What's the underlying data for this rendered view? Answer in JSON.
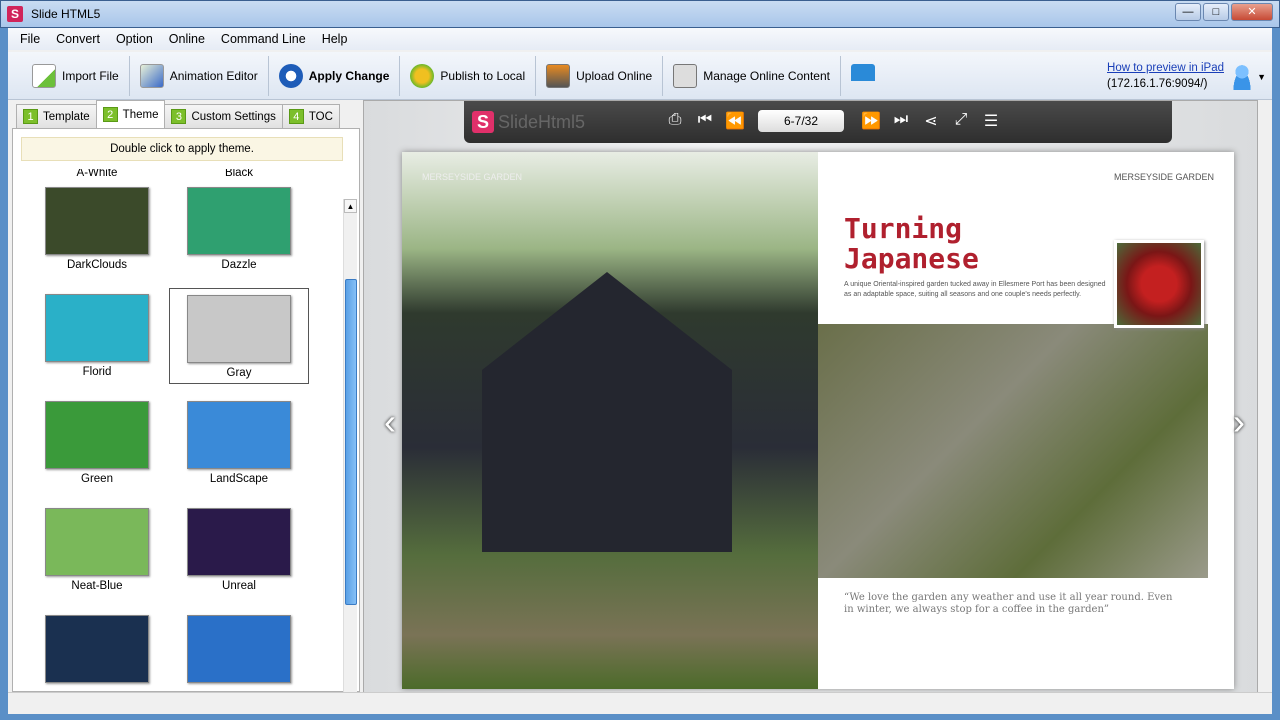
{
  "window": {
    "title": "Slide HTML5",
    "min": "—",
    "max": "□",
    "close": "✕"
  },
  "menu": [
    "File",
    "Convert",
    "Option",
    "Online",
    "Command Line",
    "Help"
  ],
  "toolbar": {
    "import": "Import File",
    "animation": "Animation Editor",
    "apply": "Apply Change",
    "publish": "Publish to Local",
    "upload": "Upload Online",
    "manage": "Manage Online Content",
    "help_link": "How to preview in iPad",
    "address": "(172.16.1.76:9094/)"
  },
  "tabs": [
    {
      "num": "1",
      "label": "Template"
    },
    {
      "num": "2",
      "label": "Theme"
    },
    {
      "num": "3",
      "label": "Custom Settings"
    },
    {
      "num": "4",
      "label": "TOC"
    }
  ],
  "hint": "Double click to apply theme.",
  "themes": [
    {
      "name": "A-White"
    },
    {
      "name": "Black"
    },
    {
      "name": "DarkClouds",
      "color": "#3b4a2a"
    },
    {
      "name": "Dazzle",
      "color": "#2fa070"
    },
    {
      "name": "Florid",
      "color": "#2ab0c8"
    },
    {
      "name": "Gray",
      "color": "#c8c8c8"
    },
    {
      "name": "Green",
      "color": "#3a9a3a"
    },
    {
      "name": "LandScape",
      "color": "#3a8ad8"
    },
    {
      "name": "Neat-Blue",
      "color": "#7ab85a"
    },
    {
      "name": "Unreal",
      "color": "#2a1a4a"
    },
    {
      "name": "",
      "color": "#1a3050"
    },
    {
      "name": "",
      "color": "#2a70c8"
    }
  ],
  "selected_theme": "Gray",
  "player": {
    "logo": "SlideHtml5",
    "page": "6-7/32"
  },
  "book": {
    "left_header": "MERSEYSIDE GARDEN",
    "right_header": "MERSEYSIDE GARDEN",
    "title_line1": "Turning",
    "title_line2": "Japanese",
    "intro": "A unique Oriental-inspired garden tucked away in Ellesmere Port has been designed as an adaptable space, suiting all seasons and one couple's needs perfectly.",
    "quote": "“We love the garden any weather and use it all year round. Even in winter, we always stop for a coffee in the garden”"
  }
}
